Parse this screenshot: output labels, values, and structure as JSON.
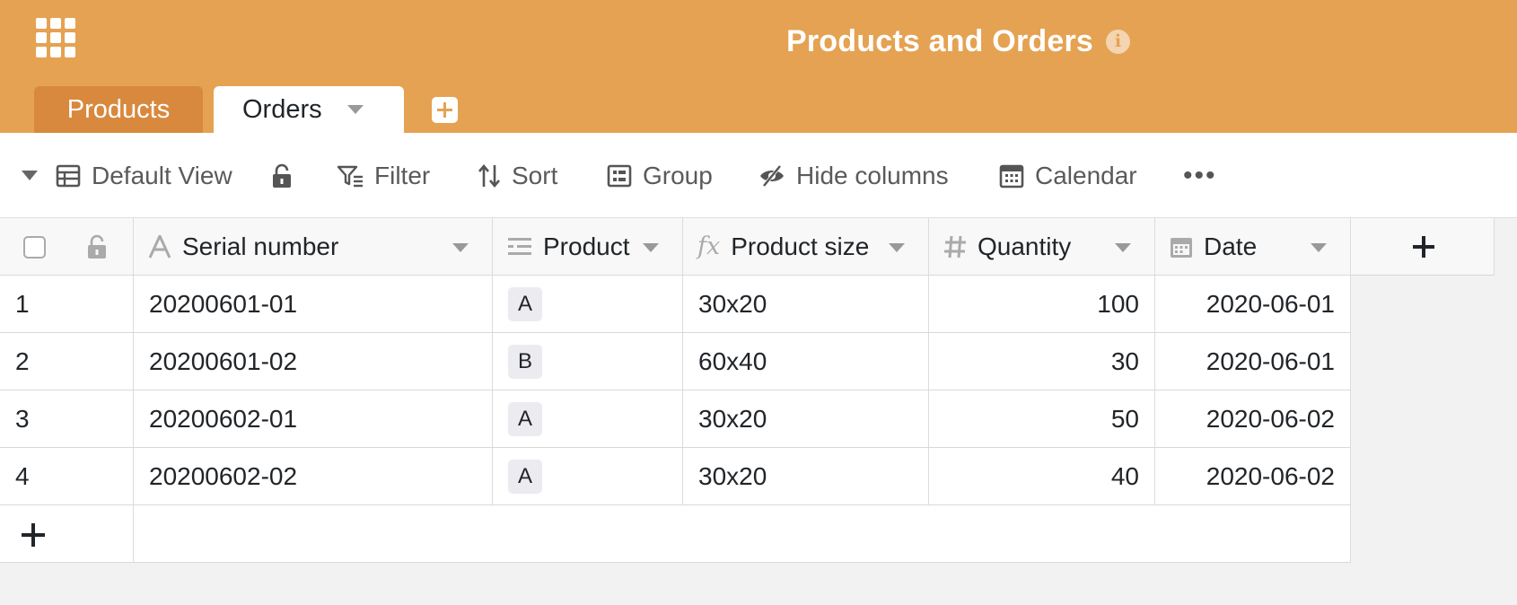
{
  "header": {
    "title": "Products and Orders",
    "info_icon": "info-icon",
    "background": "#e5a252"
  },
  "tabs": [
    {
      "label": "Products",
      "active": false
    },
    {
      "label": "Orders",
      "active": true
    }
  ],
  "toolbar": {
    "view": "Default View",
    "filter": "Filter",
    "sort": "Sort",
    "group": "Group",
    "hide_columns": "Hide columns",
    "calendar": "Calendar",
    "more": "•••"
  },
  "columns": [
    {
      "label": "Serial number",
      "icon": "text-icon"
    },
    {
      "label": "Product",
      "icon": "single-select-icon"
    },
    {
      "label": "Product size",
      "icon": "formula-icon"
    },
    {
      "label": "Quantity",
      "icon": "number-icon"
    },
    {
      "label": "Date",
      "icon": "calendar-icon"
    }
  ],
  "rows": [
    {
      "num": "1",
      "serial": "20200601-01",
      "product": "A",
      "size": "30x20",
      "quantity": "100",
      "date": "2020-06-01"
    },
    {
      "num": "2",
      "serial": "20200601-02",
      "product": "B",
      "size": "60x40",
      "quantity": "30",
      "date": "2020-06-01"
    },
    {
      "num": "3",
      "serial": "20200602-01",
      "product": "A",
      "size": "30x20",
      "quantity": "50",
      "date": "2020-06-02"
    },
    {
      "num": "4",
      "serial": "20200602-02",
      "product": "A",
      "size": "30x20",
      "quantity": "40",
      "date": "2020-06-02"
    }
  ]
}
